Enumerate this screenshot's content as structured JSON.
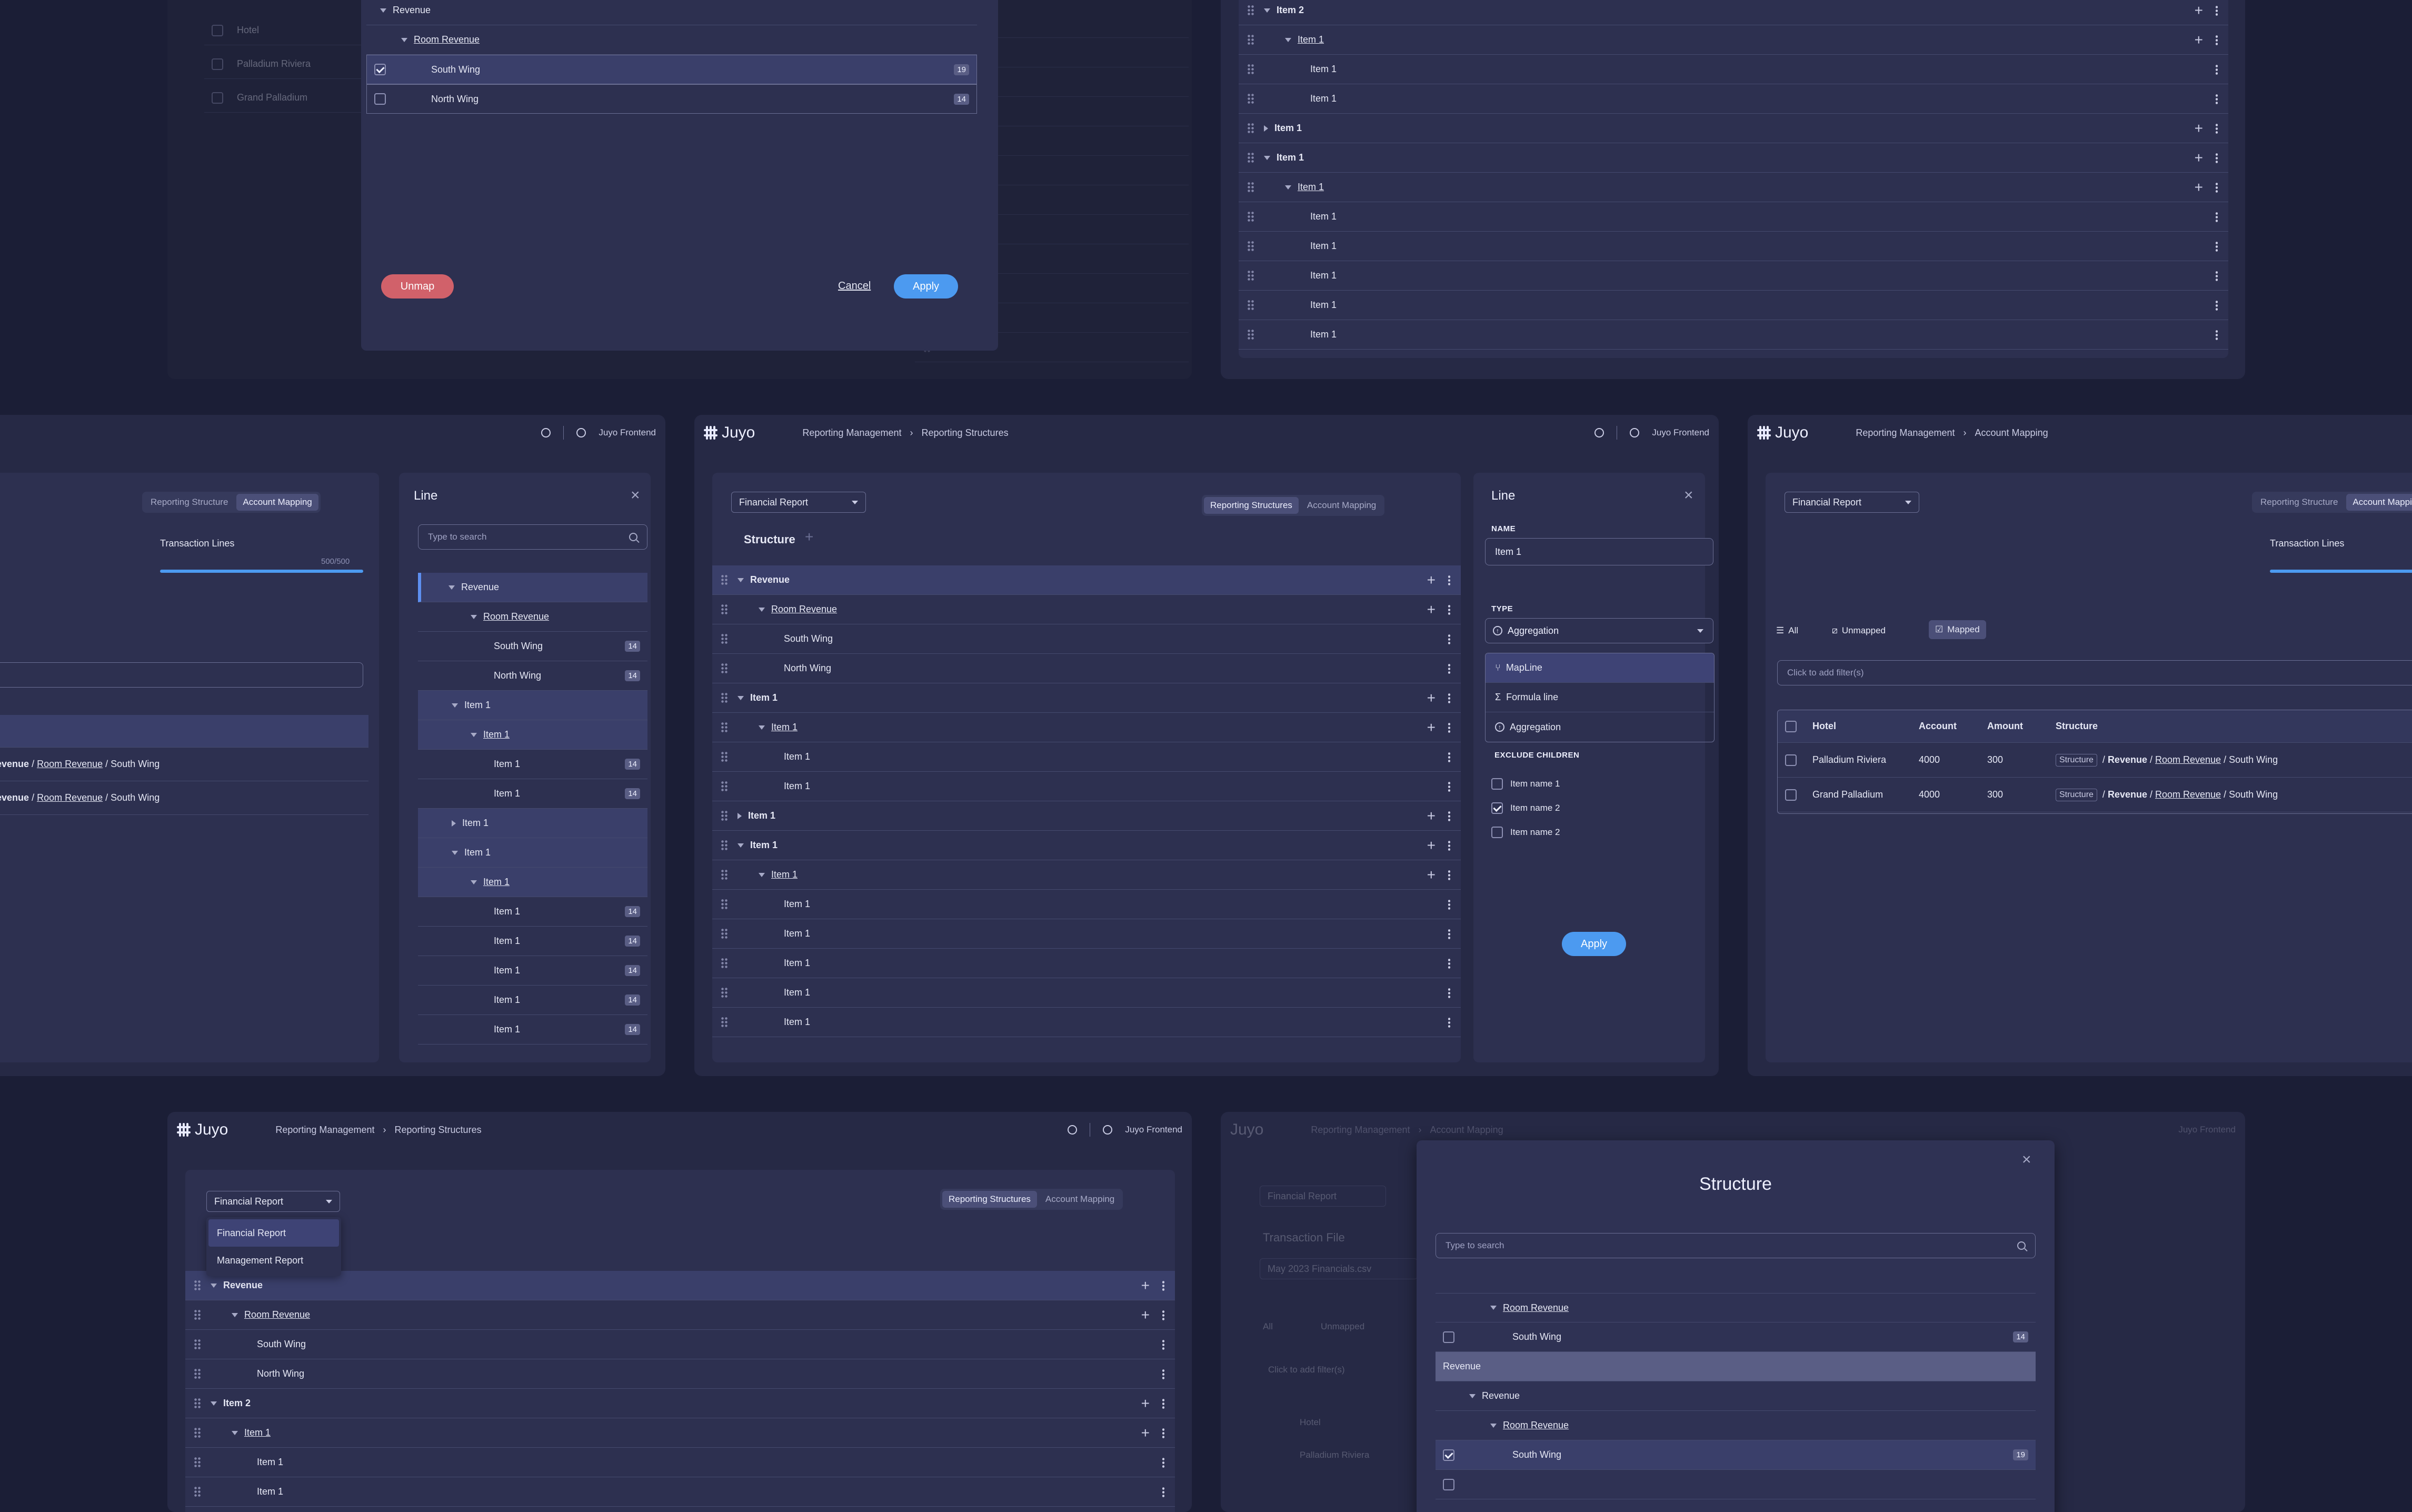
{
  "brand": {
    "logo_text": "Juyo"
  },
  "user": {
    "name": "Juyo Frontend"
  },
  "crumbs": {
    "reporting_management": "Reporting Management",
    "reporting_structures": "Reporting Structures",
    "account_mapping": "Account Mapping"
  },
  "tabs": {
    "reporting_structures": "Reporting Structures",
    "account_mapping": "Account Mapping",
    "reporting_structure_short": "Reporting Structure"
  },
  "report_select": {
    "value": "Financial Report",
    "options": [
      "Financial Report",
      "Management Report"
    ]
  },
  "structure": {
    "title": "Structure"
  },
  "tree_labels": {
    "revenue": "Revenue",
    "room_revenue": "Room Revenue",
    "south_wing": "South Wing",
    "north_wing": "North Wing",
    "item1": "Item 1",
    "item2": "Item 2"
  },
  "badges": {
    "b14": "14",
    "b19": "19"
  },
  "mapping": {
    "hotel": "Hotel",
    "account": "Account",
    "amount": "Amount",
    "structure": "Structure",
    "transaction_lines": "Transaction Lines",
    "counter": "500/500",
    "filter_placeholder": "Click to add filter(s)",
    "filter_all": "All",
    "filter_unmapped": "Unmapped",
    "filter_mapped": "Mapped",
    "row1_hotel": "Palladium Riviera",
    "row2_hotel": "Grand Palladium",
    "account_val": "4000",
    "amount_val": "300",
    "path_revenue": "Revenue",
    "path_room": "Room Revenue",
    "path_south": "South Wing",
    "path_struct": "Structure",
    "slash": "/"
  },
  "line_panel": {
    "title": "Line",
    "search_placeholder": "Type to search",
    "name_label": "NAME",
    "name_value": "Item 1",
    "type_label": "TYPE",
    "type_value": "Aggregation",
    "type_options": [
      "MapLine",
      "Formula line",
      "Aggregation"
    ],
    "exclude_label": "EXCLUDE CHILDREN",
    "exclude": [
      "Item name 1",
      "Item name 2",
      "Item name 2"
    ],
    "apply": "Apply"
  },
  "unmap_modal": {
    "unmap": "Unmap",
    "cancel": "Cancel",
    "apply": "Apply"
  },
  "structure_modal": {
    "title": "Structure",
    "search_placeholder": "Type to search"
  },
  "transaction_file": {
    "title": "Transaction File",
    "file": "May 2023 Financials.csv"
  }
}
